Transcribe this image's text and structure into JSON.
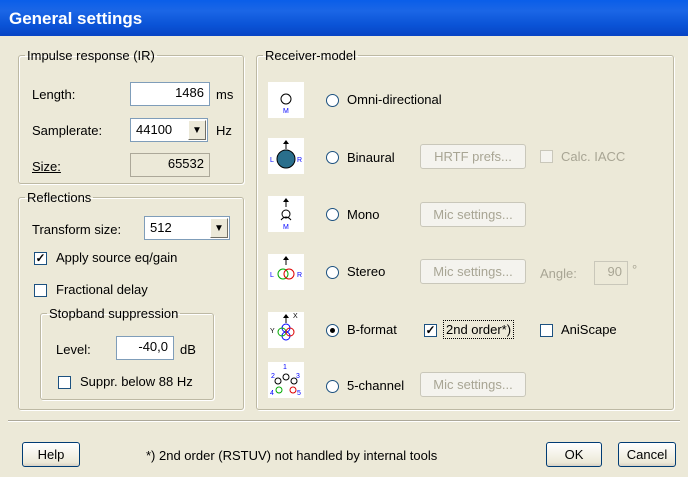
{
  "window": {
    "title": "General settings"
  },
  "ir": {
    "legend": "Impulse response (IR)",
    "length_label": "Length:",
    "length_value": "1486",
    "length_unit": "ms",
    "samplerate_label": "Samplerate:",
    "samplerate_value": "44100",
    "samplerate_unit": "Hz",
    "size_label": "Size:",
    "size_value": "65532"
  },
  "reflections": {
    "legend": "Reflections",
    "transform_label": "Transform size:",
    "transform_value": "512",
    "apply_eq_label": "Apply source eq/gain",
    "apply_eq_checked": true,
    "fractional_label": "Fractional delay",
    "fractional_checked": false,
    "stopband": {
      "legend": "Stopband suppression",
      "level_label": "Level:",
      "level_value": "-40,0",
      "level_unit": "dB",
      "suppr_label": "Suppr. below 88 Hz",
      "suppr_checked": false
    }
  },
  "receiver": {
    "legend": "Receiver-model",
    "omni": "Omni-directional",
    "binaural": "Binaural",
    "hrtf_button": "HRTF prefs...",
    "calc_iacc": "Calc. IACC",
    "mono": "Mono",
    "mono_mic": "Mic settings...",
    "stereo": "Stereo",
    "stereo_mic": "Mic settings...",
    "angle_label": "Angle:",
    "angle_value": "90",
    "angle_unit": "°",
    "bformat": "B-format",
    "second_order": "2nd order*)",
    "second_order_checked": true,
    "aniscape": "AniScape",
    "aniscape_checked": false,
    "five_channel": "5-channel",
    "five_mic": "Mic settings...",
    "selected": "B-format"
  },
  "footer": {
    "help": "Help",
    "note": "*) 2nd order (RSTUV) not handled by internal tools",
    "ok": "OK",
    "cancel": "Cancel"
  },
  "colors": {
    "titlebar": "#0a5ee9",
    "face": "#ece9d8"
  }
}
